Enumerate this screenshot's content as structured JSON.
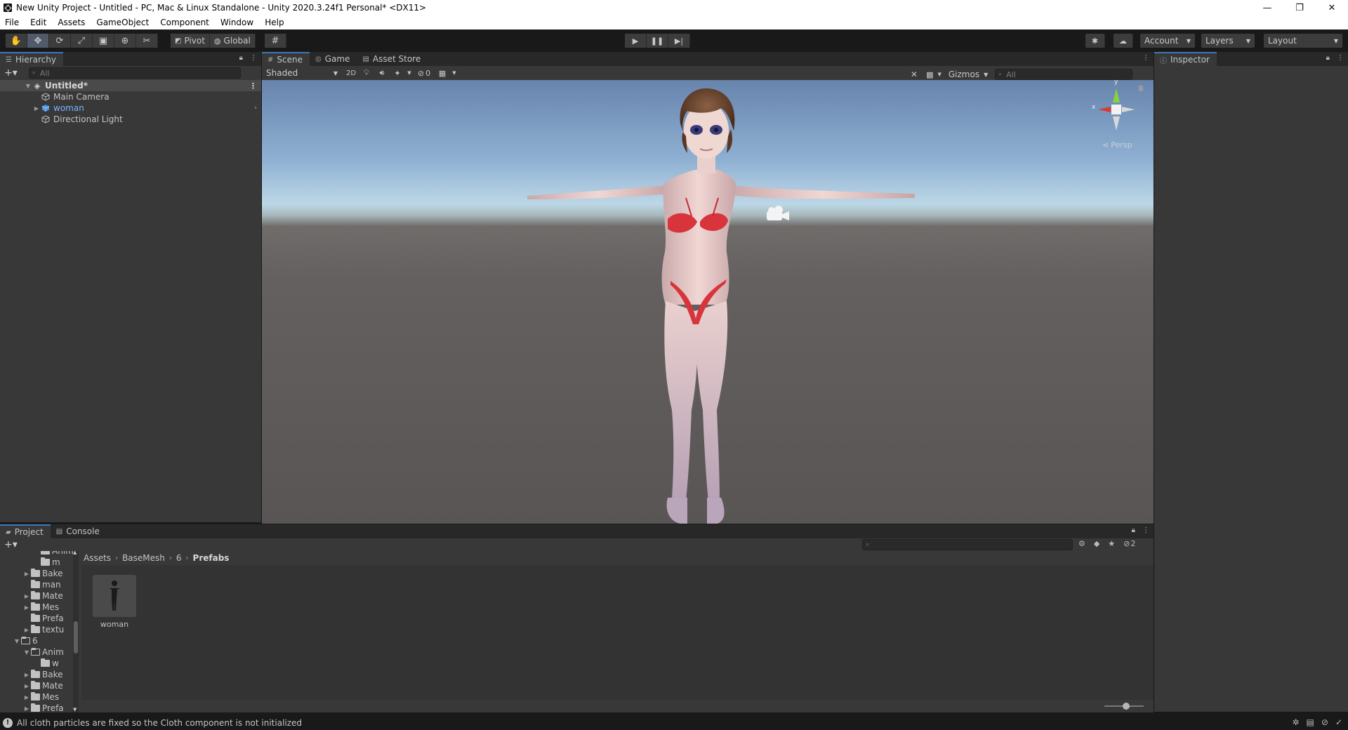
{
  "window": {
    "title": "New Unity Project - Untitled - PC, Mac & Linux Standalone - Unity 2020.3.24f1 Personal* <DX11>",
    "controls": [
      "—",
      "❐",
      "✕"
    ]
  },
  "menu": [
    "File",
    "Edit",
    "Assets",
    "GameObject",
    "Component",
    "Window",
    "Help"
  ],
  "toolbar": {
    "tools": [
      "hand-tool",
      "move-tool",
      "rotate-tool",
      "scale-tool",
      "rect-tool",
      "transform-tool",
      "custom-tool"
    ],
    "pivot_label": "Pivot",
    "global_label": "Global",
    "account_label": "Account",
    "layers_label": "Layers",
    "layout_label": "Layout"
  },
  "hierarchy": {
    "tab_label": "Hierarchy",
    "search_placeholder": "All",
    "items": [
      {
        "label": "Untitled*",
        "type": "scene"
      },
      {
        "label": "Main Camera",
        "type": "object"
      },
      {
        "label": "woman",
        "type": "prefab"
      },
      {
        "label": "Directional Light",
        "type": "object"
      }
    ]
  },
  "scene": {
    "tabs": [
      "Scene",
      "Game",
      "Asset Store"
    ],
    "shading_mode": "Shaded",
    "mode_2d": "2D",
    "hidden_count": "0",
    "gizmos_label": "Gizmos",
    "search_placeholder": "All",
    "orientation": {
      "x": "x",
      "y": "y",
      "persp": "Persp"
    }
  },
  "inspector": {
    "tab_label": "Inspector"
  },
  "project": {
    "tabs": [
      "Project",
      "Console"
    ],
    "hidden_packages": "2",
    "tree": [
      {
        "label": "Anim",
        "indent": 3,
        "arrow": "",
        "open": false
      },
      {
        "label": "m",
        "indent": 3,
        "arrow": "",
        "open": false
      },
      {
        "label": "Bake",
        "indent": 2,
        "arrow": "▶",
        "open": false
      },
      {
        "label": "man",
        "indent": 2,
        "arrow": "",
        "open": false
      },
      {
        "label": "Mate",
        "indent": 2,
        "arrow": "▶",
        "open": false
      },
      {
        "label": "Mes",
        "indent": 2,
        "arrow": "▶",
        "open": false
      },
      {
        "label": "Prefa",
        "indent": 2,
        "arrow": "",
        "open": false
      },
      {
        "label": "textu",
        "indent": 2,
        "arrow": "▶",
        "open": false
      },
      {
        "label": "6",
        "indent": 1,
        "arrow": "▼",
        "open": true
      },
      {
        "label": "Anim",
        "indent": 2,
        "arrow": "▼",
        "open": true
      },
      {
        "label": "w",
        "indent": 3,
        "arrow": "",
        "open": false
      },
      {
        "label": "Bake",
        "indent": 2,
        "arrow": "▶",
        "open": false
      },
      {
        "label": "Mate",
        "indent": 2,
        "arrow": "▶",
        "open": false
      },
      {
        "label": "Mes",
        "indent": 2,
        "arrow": "▶",
        "open": false
      },
      {
        "label": "Prefa",
        "indent": 2,
        "arrow": "▶",
        "open": false
      }
    ],
    "breadcrumb": [
      "Assets",
      "BaseMesh",
      "6",
      "Prefabs"
    ],
    "assets": [
      {
        "label": "woman"
      }
    ]
  },
  "status": {
    "message": "All cloth particles are fixed so the Cloth component is not initialized"
  },
  "colors": {
    "accent": "#3a79bb",
    "panel": "#383838",
    "prefab_text": "#7bb3ff",
    "bikini": "#d8343c"
  }
}
